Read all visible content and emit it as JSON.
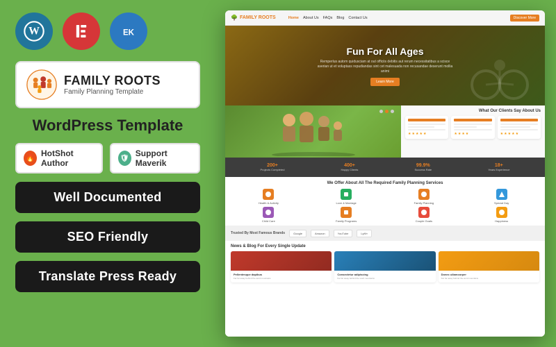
{
  "left": {
    "icons": [
      {
        "name": "WordPress",
        "abbr": "W",
        "color": "#21759b"
      },
      {
        "name": "Elementor",
        "abbr": "E",
        "color": "#d63638"
      },
      {
        "name": "Ecwid",
        "abbr": "EK",
        "color": "#2c79c1"
      }
    ],
    "brand": {
      "name": "FAMILY ROOTS",
      "sub": "Family Planning Template"
    },
    "wp_label": "WordPress Template",
    "badges": [
      {
        "name": "HotShot Author",
        "icon_type": "hotshot"
      },
      {
        "name": "Support Maverik",
        "icon_type": "support"
      }
    ],
    "features": [
      "Well Documented",
      "SEO Friendly",
      "Translate Press Ready"
    ]
  },
  "mockup": {
    "navbar": {
      "brand": "FAMILY ROOTS",
      "links": [
        "Home",
        "About Us",
        "FAQs",
        "Blog",
        "Contact Us"
      ],
      "active": "Home",
      "cta": "Discover More"
    },
    "hero": {
      "title": "Fun For All Ages",
      "subtitle": "Remperlus autom quidusciam at out officiis debitis aut rerum necessitatibus a scisce averian ut et voluptass repudiandas sint cet malesuada non recusandae deserunt mollia animi",
      "cta": "Learn More"
    },
    "testimonials": {
      "title": "What Our Clients Say About Us",
      "cards": [
        {
          "color": "#e67e22"
        },
        {
          "color": "#e67e22"
        },
        {
          "color": "#e67e22"
        }
      ]
    },
    "stats": [
      {
        "num": "200+",
        "label": "Projects Completed"
      },
      {
        "num": "400+",
        "label": "Happy Clients"
      },
      {
        "num": "99.9%",
        "label": "Success Rate"
      },
      {
        "num": "18+",
        "label": "Years Experience"
      }
    ],
    "services": {
      "title": "We Offer About All The Required Family Planning Services",
      "items": [
        {
          "label": "Health & Activity",
          "color": "#e67e22"
        },
        {
          "label": "Love & Marriage",
          "color": "#27ae60"
        },
        {
          "label": "Family Planning",
          "color": "#e67e22"
        },
        {
          "label": "Special Day",
          "color": "#3498db"
        },
        {
          "label": "Child Care",
          "color": "#9b59b6"
        },
        {
          "label": "Family Programs",
          "color": "#e67e22"
        },
        {
          "label": "Couple Goals",
          "color": "#e74c3c"
        },
        {
          "label": "Happiness",
          "color": "#f39c12"
        }
      ]
    },
    "trusted": {
      "label": "Trusted By Most Famous Brands",
      "logos": [
        "Google",
        "Amazon",
        "YouTube",
        "Lyft/»"
      ]
    },
    "blog": {
      "title": "News & Blog For Every Single Update",
      "cards": [
        {
          "img_color": "#c0392b",
          "title": "Pellentesque dapibus",
          "text": "Far far away behind the word mountains"
        },
        {
          "img_color": "#3498db",
          "title": "Consectetur adipiscing",
          "text": "Far far away behind the word mountains"
        },
        {
          "img_color": "#f39c12",
          "title": "Donec ullamcorper",
          "text": "Far far away behind the word mountains"
        }
      ]
    }
  }
}
